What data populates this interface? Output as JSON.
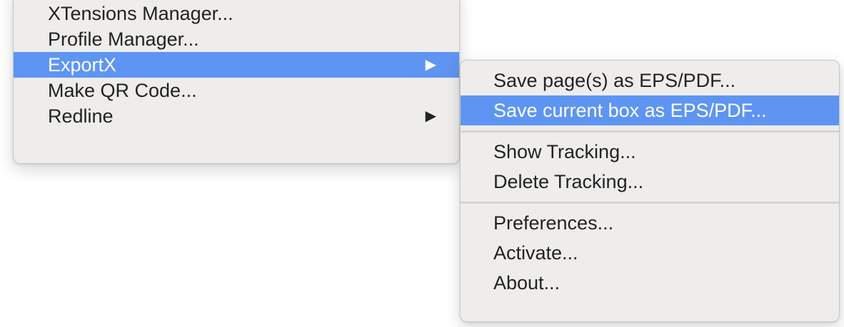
{
  "main_menu": {
    "items": [
      {
        "label": "XTensions Manager...",
        "has_submenu": false,
        "highlighted": false
      },
      {
        "label": "Profile Manager...",
        "has_submenu": false,
        "highlighted": false
      },
      {
        "label": "ExportX",
        "has_submenu": true,
        "highlighted": true
      },
      {
        "label": "Make QR Code...",
        "has_submenu": false,
        "highlighted": false
      },
      {
        "label": "Redline",
        "has_submenu": true,
        "highlighted": false
      }
    ],
    "submenu_arrow": "▶"
  },
  "submenu": {
    "groups": [
      [
        {
          "label": "Save page(s) as EPS/PDF...",
          "highlighted": false
        },
        {
          "label": "Save current box as EPS/PDF...",
          "highlighted": true
        }
      ],
      [
        {
          "label": "Show Tracking...",
          "highlighted": false
        },
        {
          "label": "Delete Tracking...",
          "highlighted": false
        }
      ],
      [
        {
          "label": "Preferences...",
          "highlighted": false
        },
        {
          "label": "Activate...",
          "highlighted": false
        },
        {
          "label": "About...",
          "highlighted": false
        }
      ]
    ]
  },
  "colors": {
    "menu_background": "#eeedeb",
    "highlight": "#5e95f2",
    "text": "#232323",
    "highlight_text": "#ffffff"
  }
}
